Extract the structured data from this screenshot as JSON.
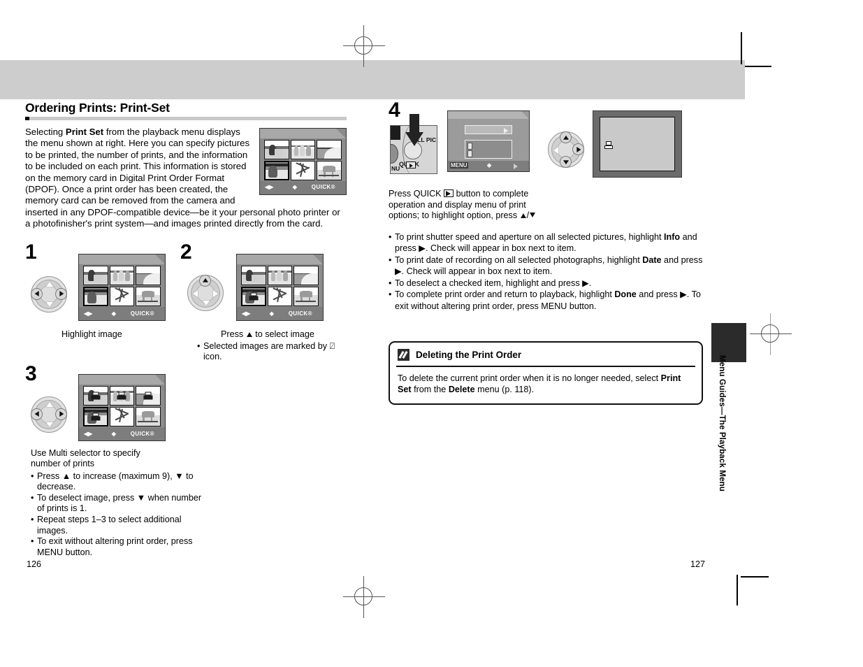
{
  "document": {
    "left_page_number": "126",
    "right_page_number": "127",
    "side_tab_label": "Menu Guides—The Playback Menu"
  },
  "left_page": {
    "heading": "Ordering Prints: Print-Set",
    "intro": {
      "part1": "Selecting ",
      "bold1": "Print Set",
      "part2": " from the playback menu displays the menu shown at right. Here you can specify pictures to be printed, the number of prints, and the information to be included on each print. This information is stored on the memory card in Digital Print Order Format (DPOF). Once a print order has been created, the memory card can be removed from the camera and inserted in any DPOF-compatible device—be it your personal photo printer or a photofinisher's print system—and images printed directly from the card."
    },
    "lcd_status": {
      "left_right": "◀▶",
      "up_down": "◆",
      "quick": "QUICK®"
    },
    "steps": [
      {
        "number": "1",
        "caption": "Highlight image",
        "bullets": []
      },
      {
        "number": "2",
        "caption_pre": "Press ",
        "caption_arrow": "▲",
        "caption_post": " to select image",
        "bullets": [
          "Selected images are marked by ⍁ icon."
        ]
      },
      {
        "number": "3",
        "caption_line1": "Use Multi selector to specify",
        "caption_line2": "number of prints",
        "bullets": [
          "Press ▲ to increase (maximum 9), ▼ to decrease.",
          "To deselect image, press ▼ when number of prints is 1.",
          "Repeat steps 1–3 to select additional images.",
          "To exit without altering print order, press MENU button."
        ]
      }
    ]
  },
  "right_page": {
    "step": {
      "number": "4",
      "camera": {
        "quick_label": "QUICK",
        "allpic_label": "LL PIC",
        "menu_label": "NU"
      },
      "menu_screen": {
        "menu_label": "MENU",
        "up_down": "◆"
      },
      "caption": "Press QUICK ▶ button to complete operation and display menu of print options; to highlight option, press ▲/▼"
    },
    "bullets": [
      {
        "pre": "To print shutter speed and aperture on all selected pictures, highlight ",
        "bold": "Info",
        "post": " and press ▶. Check will appear in box next to item."
      },
      {
        "pre": "To print date of recording on all selected photographs, highlight ",
        "bold": "Date",
        "post": " and press ▶. Check will appear in box next to item."
      },
      {
        "pre": "To deselect a checked item, highlight and press ▶.",
        "bold": "",
        "post": ""
      },
      {
        "pre": "To complete print order and return to playback, highlight ",
        "bold": "Done",
        "post": " and press ▶. To exit without altering print order, press MENU button."
      }
    ],
    "note": {
      "title": "Deleting the Print Order",
      "body_pre": "To delete the current print order when it is no longer needed, select ",
      "body_bold1": "Print Set",
      "body_mid": " from the ",
      "body_bold2": "Delete",
      "body_post": " menu (p. 118)."
    }
  },
  "colors": {
    "heading_rule": "#c9c9c9",
    "band": "#cdcdcd",
    "tab": "#2b2b2b",
    "lcd_body": "#8c8c8c",
    "lcd_status": "#7d7d7d"
  }
}
